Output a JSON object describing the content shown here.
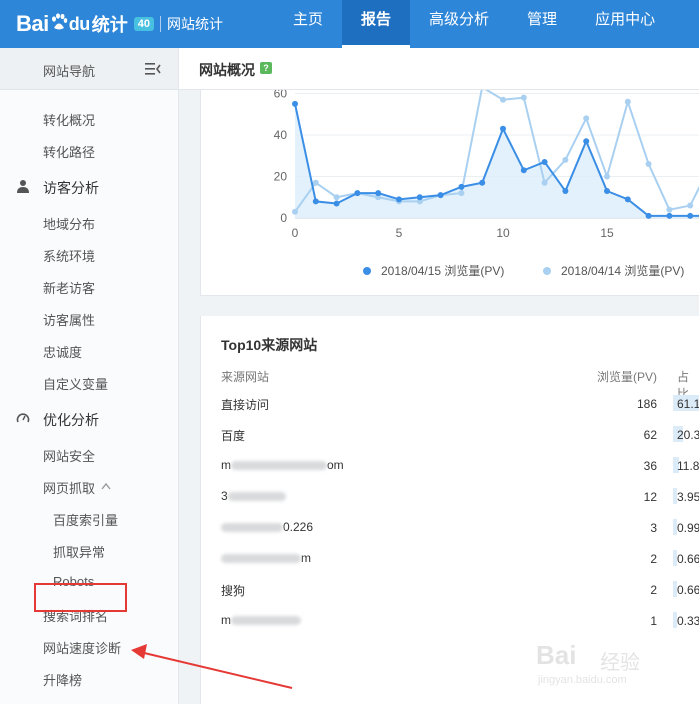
{
  "app": {
    "logo_bai": "Bai",
    "logo_du": "du",
    "logo_tongji": "统计",
    "logo_badge": "40",
    "logo_sub": "网站统计"
  },
  "nav": {
    "items": [
      {
        "label": "主页",
        "active": false
      },
      {
        "label": "报告",
        "active": true
      },
      {
        "label": "高级分析",
        "active": false
      },
      {
        "label": "管理",
        "active": false
      },
      {
        "label": "应用中心",
        "active": false
      }
    ]
  },
  "sidebar": {
    "header": "网站导航",
    "items": {
      "conv_overview": "转化概况",
      "conv_path": "转化路径",
      "visitor_analysis": "访客分析",
      "region": "地域分布",
      "sys_env": "系统环境",
      "new_old": "新老访客",
      "attrs": "访客属性",
      "loyalty": "忠诚度",
      "custom_var": "自定义变量",
      "optimize": "优化分析",
      "site_security": "网站安全",
      "crawl": "网页抓取",
      "baidu_index": "百度索引量",
      "crawl_error": "抓取异常",
      "robots": "Robots",
      "search_rank": "搜索词排名",
      "speed_diag": "网站速度诊断",
      "rise_fall": "升降榜"
    }
  },
  "main": {
    "title": "网站概况",
    "help": "?"
  },
  "chart_data": {
    "type": "line",
    "x_ticks": [
      0,
      5,
      10,
      15
    ],
    "y_ticks": [
      0,
      20,
      40,
      60
    ],
    "ylim": [
      0,
      60
    ],
    "grid": true,
    "legend_position": "bottom",
    "series": [
      {
        "name": "2018/04/15 浏览量(PV)",
        "color": "#3a8ee6",
        "x": [
          0,
          1,
          2,
          3,
          4,
          5,
          6,
          7,
          8,
          9,
          10,
          11,
          12,
          13,
          14,
          15,
          16,
          17,
          18,
          19,
          20
        ],
        "values": [
          55,
          8,
          7,
          12,
          12,
          9,
          10,
          11,
          15,
          17,
          43,
          23,
          27,
          13,
          37,
          13,
          9,
          1,
          1,
          1,
          1
        ]
      },
      {
        "name": "2018/04/14 浏览量(PV)",
        "color": "#a9d0f0",
        "x": [
          0,
          1,
          2,
          3,
          4,
          5,
          6,
          7,
          8,
          9,
          10,
          11,
          12,
          13,
          14,
          15,
          16,
          17,
          18,
          19,
          20
        ],
        "values": [
          3,
          17,
          10,
          12,
          10,
          8,
          8,
          11,
          12,
          63,
          57,
          58,
          17,
          28,
          48,
          20,
          56,
          26,
          4,
          6,
          26
        ]
      }
    ]
  },
  "table": {
    "title": "Top10来源网站",
    "col_site": "来源网站",
    "col_pv": "浏览量(PV)",
    "col_pct": "占比",
    "rows": [
      {
        "site": "直接访问",
        "pv": "186",
        "pct": "61.1"
      },
      {
        "site": "百度",
        "pv": "62",
        "pct": "20.3"
      },
      {
        "site": "m",
        "site_tail": "om",
        "pv": "36",
        "pct": "11.8"
      },
      {
        "site": "3",
        "site_tail": "",
        "pv": "12",
        "pct": "3.95"
      },
      {
        "site": "",
        "site_tail": "0.226",
        "pv": "3",
        "pct": "0.99"
      },
      {
        "site": "",
        "site_tail": "m",
        "pv": "2",
        "pct": "0.66"
      },
      {
        "site": "搜狗",
        "pv": "2",
        "pct": "0.66"
      },
      {
        "site": "m",
        "site_tail": "",
        "pv": "1",
        "pct": "0.33"
      }
    ]
  },
  "watermark": {
    "text": "Bai",
    "jy": "经验",
    "url": "jingyan.baidu.com"
  }
}
